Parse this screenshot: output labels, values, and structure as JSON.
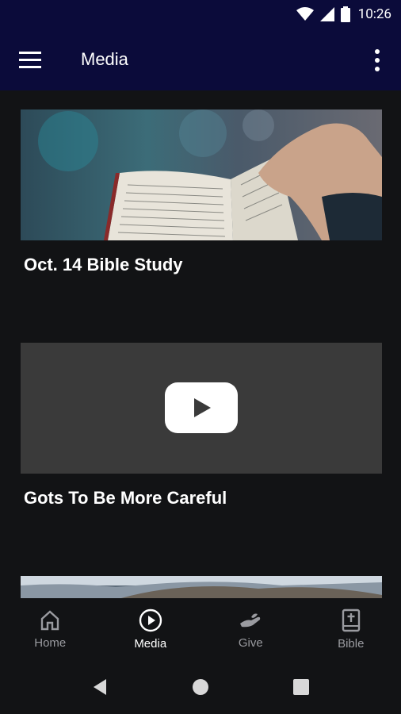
{
  "status": {
    "time": "10:26"
  },
  "app_bar": {
    "title": "Media"
  },
  "cards": [
    {
      "title": "Oct. 14 Bible Study"
    },
    {
      "title": "Gots To Be More Careful"
    },
    {
      "title": ""
    }
  ],
  "bottom_nav": [
    {
      "label": "Home",
      "icon": "home-icon"
    },
    {
      "label": "Media",
      "icon": "play-circle-icon"
    },
    {
      "label": "Give",
      "icon": "give-hand-icon"
    },
    {
      "label": "Bible",
      "icon": "bible-icon"
    }
  ],
  "colors": {
    "app_bar": "#0b0b3a",
    "background": "#121315",
    "video_placeholder": "#3a3a3a"
  }
}
